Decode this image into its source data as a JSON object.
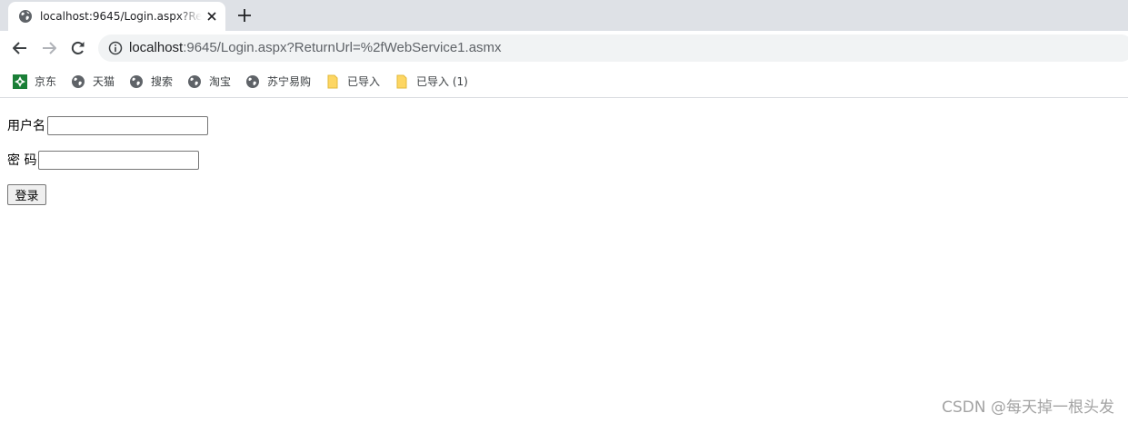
{
  "browser": {
    "tab": {
      "title": "localhost:9645/Login.aspx?ReturnUrl=%2fWebService1.asmx"
    },
    "address_bar": {
      "host": "localhost",
      "rest": ":9645/Login.aspx?ReturnUrl=%2fWebService1.asmx"
    },
    "bookmarks": [
      {
        "label": "京东",
        "icon": "jd-favicon-icon"
      },
      {
        "label": "天猫",
        "icon": "globe-icon"
      },
      {
        "label": "搜索",
        "icon": "globe-icon"
      },
      {
        "label": "淘宝",
        "icon": "globe-icon"
      },
      {
        "label": "苏宁易购",
        "icon": "globe-icon"
      },
      {
        "label": "已导入",
        "icon": "folder-icon"
      },
      {
        "label": "已导入 (1)",
        "icon": "folder-icon"
      }
    ]
  },
  "login_form": {
    "username_label": "用户名",
    "username_value": "",
    "password_label": "密 码",
    "password_value": "",
    "submit_label": "登录"
  },
  "watermark": "CSDN @每天掉一根头发",
  "colors": {
    "tabstrip": "#dee1e6",
    "omnibox": "#f1f3f4",
    "folder": "#fdd663",
    "jd_green": "#1a7f37"
  }
}
